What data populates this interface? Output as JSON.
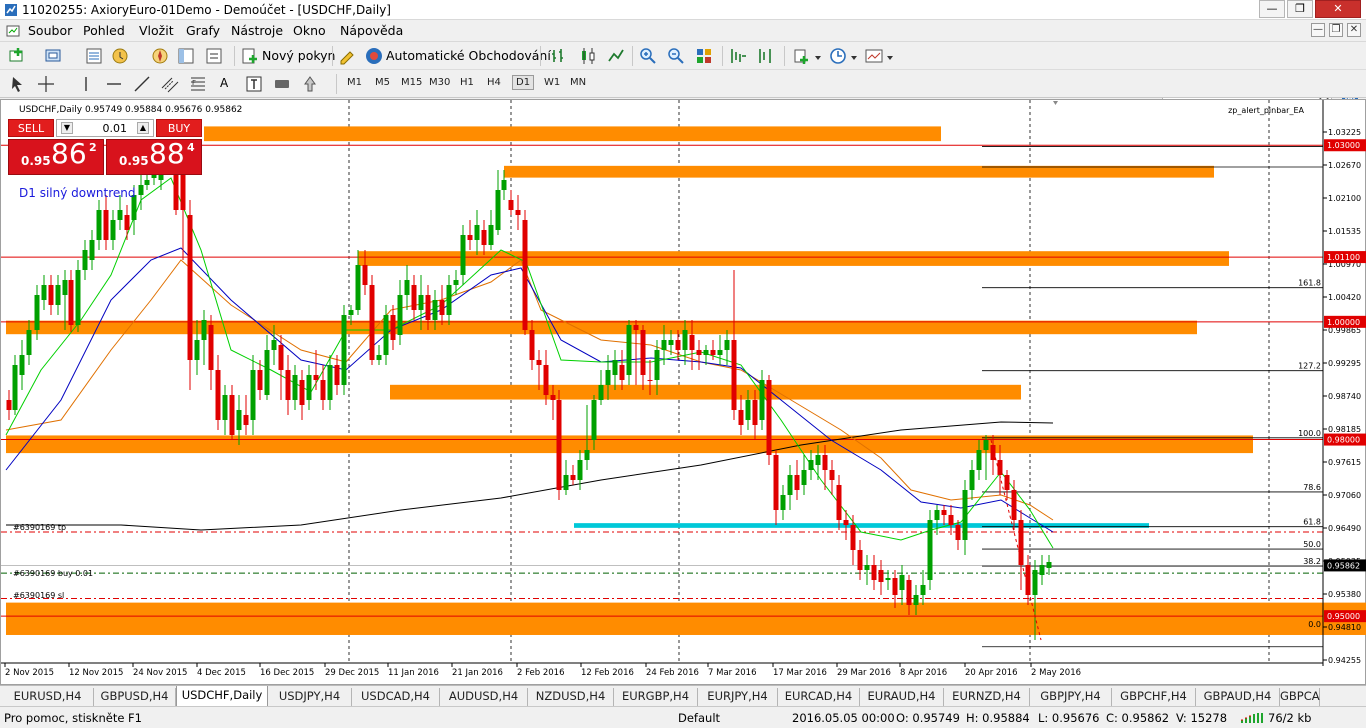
{
  "window": {
    "title": "11020255: AxioryEuro-01Demo - Demoúčet - [USDCHF,Daily]"
  },
  "menu": [
    "Soubor",
    "Pohled",
    "Vložit",
    "Grafy",
    "Nástroje",
    "Okno",
    "Nápověda"
  ],
  "toolbar": {
    "new_order": "Nový pokyn",
    "auto_trading": "Automatické Obchodování"
  },
  "timeframes": [
    "M1",
    "M5",
    "M15",
    "M30",
    "H1",
    "H4",
    "D1",
    "W1",
    "MN"
  ],
  "selected_timeframe": "D1",
  "chart": {
    "header": "USDCHF,Daily  0.95749 0.95884 0.95676 0.95862",
    "annotation": "D1 silný downtrend",
    "ea_label": "zp_alert_pinbar_EA",
    "trade_labels": {
      "tp": "#6390169 tp",
      "buy": "#6390169 buy 0.01",
      "sl": "#6390169 sl"
    },
    "fib_levels": [
      "161.8",
      "127.2",
      "100.0",
      "78.6",
      "61.8",
      "50.0",
      "38.2",
      "0.0"
    ],
    "price_axis": [
      "1.03225",
      "1.02670",
      "1.02100",
      "1.01535",
      "1.00970",
      "1.00420",
      "0.99865",
      "0.99295",
      "0.98740",
      "0.98185",
      "0.97615",
      "0.97060",
      "0.96490",
      "0.95935",
      "0.95380",
      "0.94810",
      "0.94255"
    ],
    "price_boxes": [
      {
        "text": "1.03000",
        "color": "#e00000"
      },
      {
        "text": "1.01100",
        "color": "#e00000"
      },
      {
        "text": "1.00000",
        "color": "#e00000"
      },
      {
        "text": "0.98000",
        "color": "#e00000"
      },
      {
        "text": "0.95862",
        "color": "#000000"
      },
      {
        "text": "0.95000",
        "color": "#e00000"
      }
    ],
    "date_axis": [
      "2 Nov 2015",
      "12 Nov 2015",
      "24 Nov 2015",
      "4 Dec 2015",
      "16 Dec 2015",
      "29 Dec 2015",
      "11 Jan 2016",
      "21 Jan 2016",
      "2 Feb 2016",
      "12 Feb 2016",
      "24 Feb 2016",
      "7 Mar 2016",
      "17 Mar 2016",
      "29 Mar 2016",
      "8 Apr 2016",
      "20 Apr 2016",
      "2 May 2016"
    ],
    "colors": {
      "zone": "#ff8c00",
      "tp_zone": "#00c8d8",
      "bull": "#00a000",
      "bear": "#e00000",
      "fast_ma": "#00d000",
      "mid_ma": "#0000c0",
      "slow_ma": "#e07000",
      "long_ma": "#000000"
    }
  },
  "one_click": {
    "sell": "SELL",
    "buy": "BUY",
    "lot": "0.01",
    "sell_price": {
      "small": "0.95",
      "big": "86",
      "sup": "2"
    },
    "buy_price": {
      "small": "0.95",
      "big": "88",
      "sup": "4"
    }
  },
  "tabs": [
    "EURUSD,H4",
    "GBPUSD,H4",
    "USDCHF,Daily",
    "USDJPY,H4",
    "USDCAD,H4",
    "AUDUSD,H4",
    "NZDUSD,H4",
    "EURGBP,H4",
    "EURJPY,H4",
    "EURCAD,H4",
    "EURAUD,H4",
    "EURNZD,H4",
    "GBPJPY,H4",
    "GBPCHF,H4",
    "GBPAUD,H4",
    "GBPCA"
  ],
  "active_tab": "USDCHF,Daily",
  "status": {
    "help": "Pro pomoc, stiskněte F1",
    "profile": "Default",
    "datetime": "2016.05.05 00:00",
    "open": "O: 0.95749",
    "high": "H: 0.95884",
    "low": "L: 0.95676",
    "close": "C: 0.95862",
    "volume": "V: 15278",
    "traffic": "76/2 kb"
  }
}
